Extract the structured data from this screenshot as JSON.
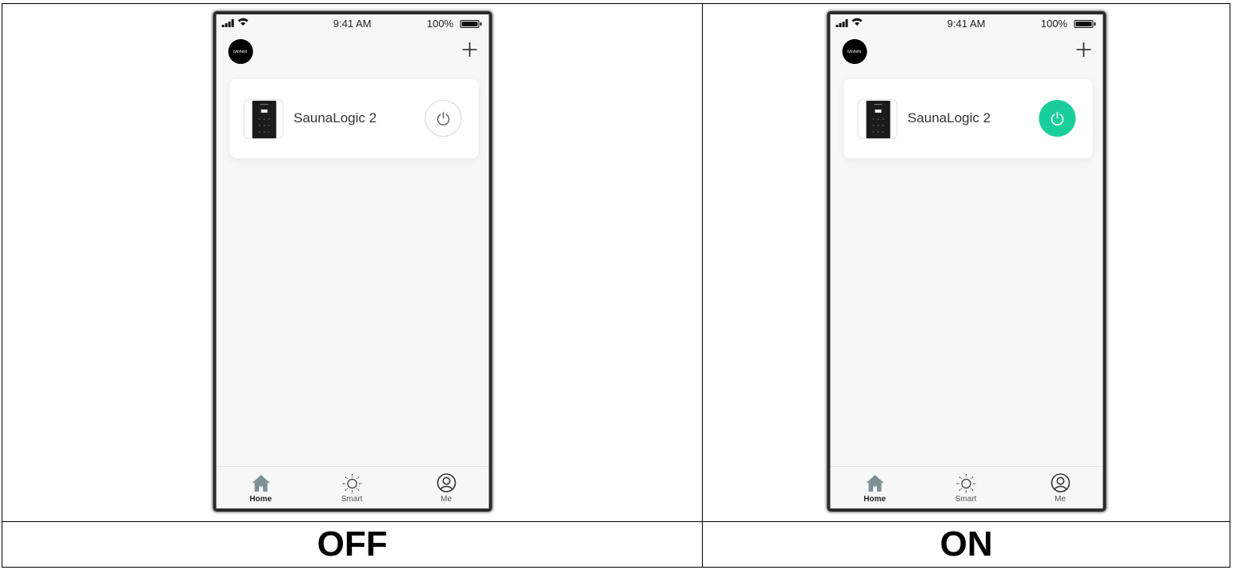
{
  "panels": [
    {
      "caption": "OFF",
      "status_bar": {
        "time": "9:41 AM",
        "battery": "100%"
      },
      "logo_text": "tylohelo",
      "device": {
        "name": "SaunaLogic 2",
        "power_state": "off"
      },
      "tabs": [
        {
          "label": "Home",
          "icon": "home-icon",
          "active": true
        },
        {
          "label": "Smart",
          "icon": "sun-icon",
          "active": false
        },
        {
          "label": "Me",
          "icon": "profile-icon",
          "active": false
        }
      ]
    },
    {
      "caption": "ON",
      "status_bar": {
        "time": "9:41 AM",
        "battery": "100%"
      },
      "logo_text": "tylohelo",
      "device": {
        "name": "SaunaLogic 2",
        "power_state": "on"
      },
      "tabs": [
        {
          "label": "Home",
          "icon": "home-icon",
          "active": true
        },
        {
          "label": "Smart",
          "icon": "sun-icon",
          "active": false
        },
        {
          "label": "Me",
          "icon": "profile-icon",
          "active": false
        }
      ]
    }
  ],
  "colors": {
    "power_on": "#19ce9a",
    "power_off_bg": "#ffffff",
    "tab_icon": "#7e9194",
    "screen_bg": "#f7f7f7"
  }
}
